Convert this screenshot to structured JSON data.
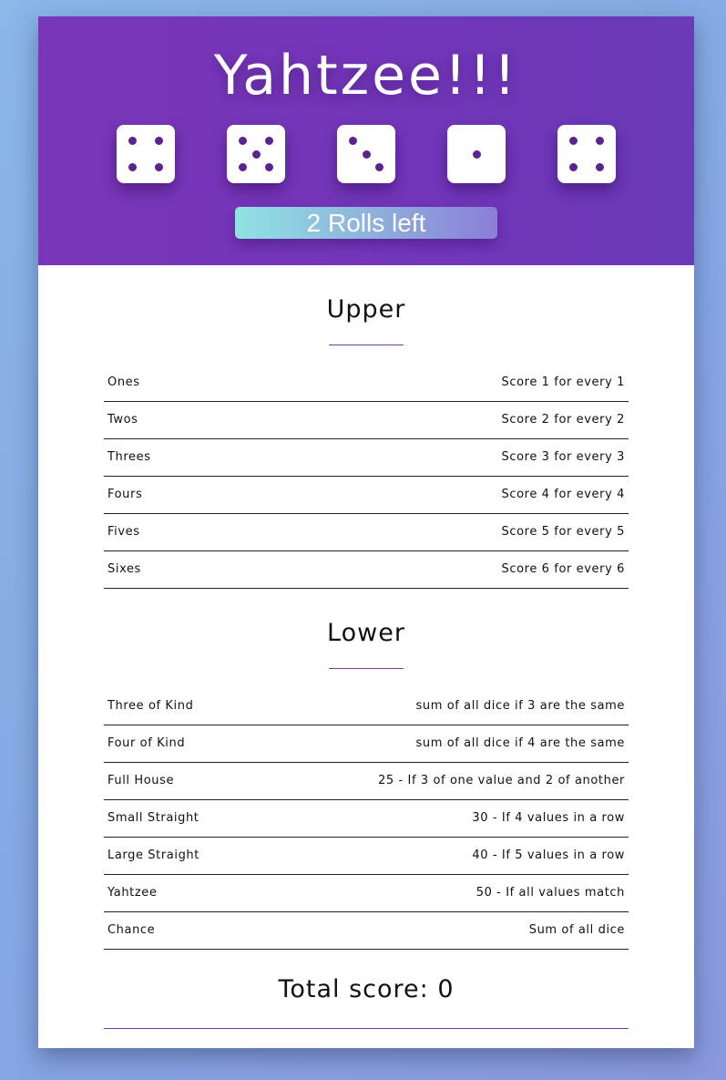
{
  "header": {
    "title": "Yahtzee!!!",
    "roll_button": "2 Rolls left"
  },
  "dice": [
    4,
    5,
    3,
    1,
    4
  ],
  "colors": {
    "pip": "#5a2390",
    "header": "#7236ba",
    "accent_line": "#7a3aa8"
  },
  "upper": {
    "title": "Upper",
    "rows": [
      {
        "name": "Ones",
        "desc": "Score 1 for every 1"
      },
      {
        "name": "Twos",
        "desc": "Score 2 for every 2"
      },
      {
        "name": "Threes",
        "desc": "Score 3 for every 3"
      },
      {
        "name": "Fours",
        "desc": "Score 4 for every 4"
      },
      {
        "name": "Fives",
        "desc": "Score 5 for every 5"
      },
      {
        "name": "Sixes",
        "desc": "Score 6 for every 6"
      }
    ]
  },
  "lower": {
    "title": "Lower",
    "rows": [
      {
        "name": "Three of Kind",
        "desc": "sum of all dice if 3 are the same"
      },
      {
        "name": "Four of Kind",
        "desc": "sum of all dice if 4 are the same"
      },
      {
        "name": "Full House",
        "desc": "25 - If 3 of one value and 2 of another"
      },
      {
        "name": "Small Straight",
        "desc": "30 - If 4 values in a row"
      },
      {
        "name": "Large Straight",
        "desc": "40 - If 5 values in a row"
      },
      {
        "name": "Yahtzee",
        "desc": "50 - If all values match"
      },
      {
        "name": "Chance",
        "desc": "Sum of all dice"
      }
    ]
  },
  "total": {
    "label": "Total score: 0"
  }
}
